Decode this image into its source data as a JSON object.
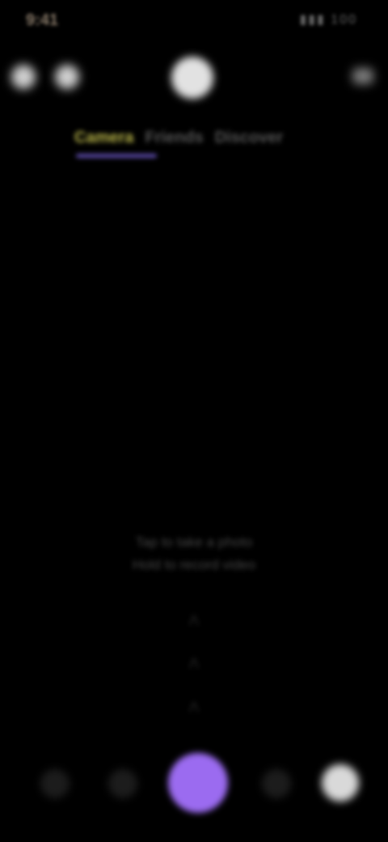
{
  "status": {
    "time": "9:41",
    "indicators": "▮▮▮ 100"
  },
  "header": {
    "left_icons": [
      "settings-icon",
      "filter-icon"
    ],
    "right_icon": "more-icon"
  },
  "modes": [
    {
      "label": "Camera",
      "active": true
    },
    {
      "label": "Friends",
      "active": false
    },
    {
      "label": "Discover",
      "active": false
    }
  ],
  "hint": {
    "line1": "Tap to take a photo",
    "line2": "Hold to record video",
    "swipe_glyphs": [
      "˄",
      "˄",
      "˄"
    ]
  },
  "bottom_bar": {
    "items": [
      "gallery-icon",
      "flash-icon",
      "capture-button",
      "flip-camera-icon",
      "profile-avatar"
    ]
  },
  "colors": {
    "accent": "#9b6bf0",
    "active_mode": "#b9b64a",
    "background": "#000000"
  }
}
